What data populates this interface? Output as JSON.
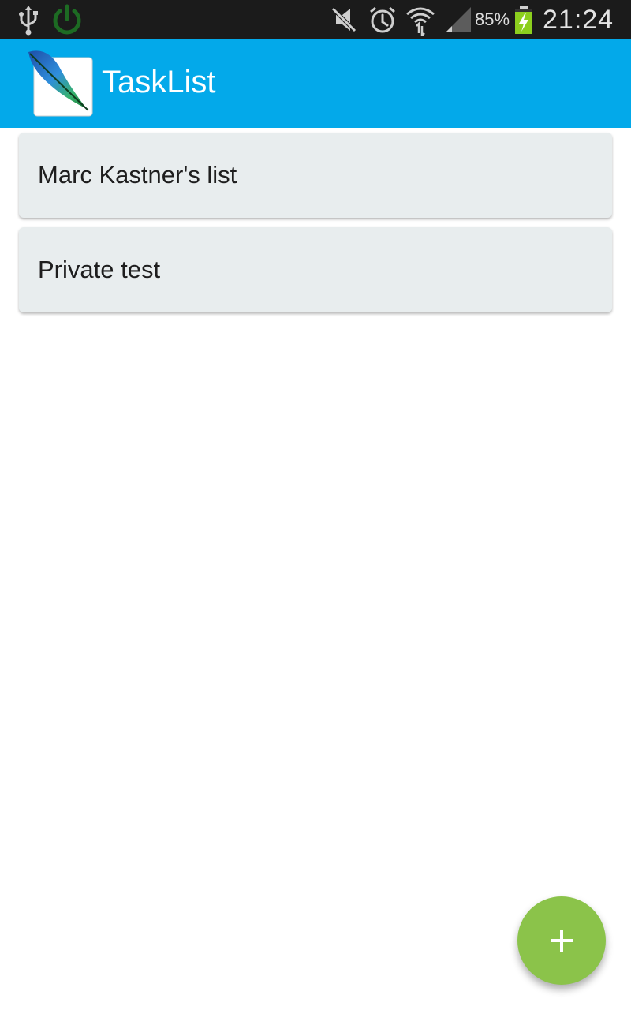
{
  "status_bar": {
    "icons": [
      "usb-icon",
      "power-icon",
      "mute-icon",
      "alarm-icon",
      "wifi-icon",
      "signal-icon",
      "battery-charging-icon"
    ],
    "battery": "85%",
    "time": "21:24"
  },
  "app_bar": {
    "title": "TaskList",
    "logo": "feather-logo"
  },
  "lists": [
    {
      "name": "Marc Kastner's list"
    },
    {
      "name": "Private test"
    }
  ],
  "fab": {
    "icon": "plus-icon"
  },
  "colors": {
    "app_bar": "#03a9ea",
    "status_bar": "#1b1b1b",
    "card": "#e8edee",
    "fab": "#8bc34a"
  }
}
